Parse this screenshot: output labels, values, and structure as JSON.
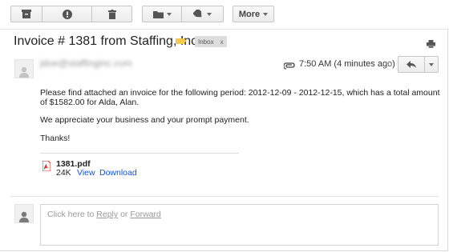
{
  "toolbar": {
    "buttons": [
      {
        "icon": "archive-icon"
      },
      {
        "icon": "report-spam-icon"
      },
      {
        "icon": "delete-icon"
      },
      {
        "icon": "move-to-folder-icon"
      },
      {
        "icon": "labels-icon"
      }
    ],
    "more_label": "More"
  },
  "thread": {
    "subject": "Invoice # 1381 from Staffing, Inc.",
    "label_color": "#f7cb4d",
    "inbox_chip": "Inbox",
    "chip_close": "x"
  },
  "message": {
    "sender": "jdoe@staffinginc.com",
    "time": "7:50 AM (4 minutes ago)",
    "body_p1": "Please find attached an invoice for the following period: 2012-12-09 - 2012-12-15, which has a total amount of $1582.00 for Alda, Alan.",
    "body_p2": "We appreciate your business and your prompt payment.",
    "body_p3": "Thanks!",
    "attachment": {
      "name": "1381.pdf",
      "size": "24K",
      "view": "View",
      "download": "Download"
    }
  },
  "reply": {
    "prefix": "Click here to",
    "reply": "Reply",
    "or": "or",
    "forward": "Forward"
  },
  "colors": {
    "link": "#1155cc",
    "label": "#f7cb4d",
    "pdf_red": "#d93025"
  }
}
